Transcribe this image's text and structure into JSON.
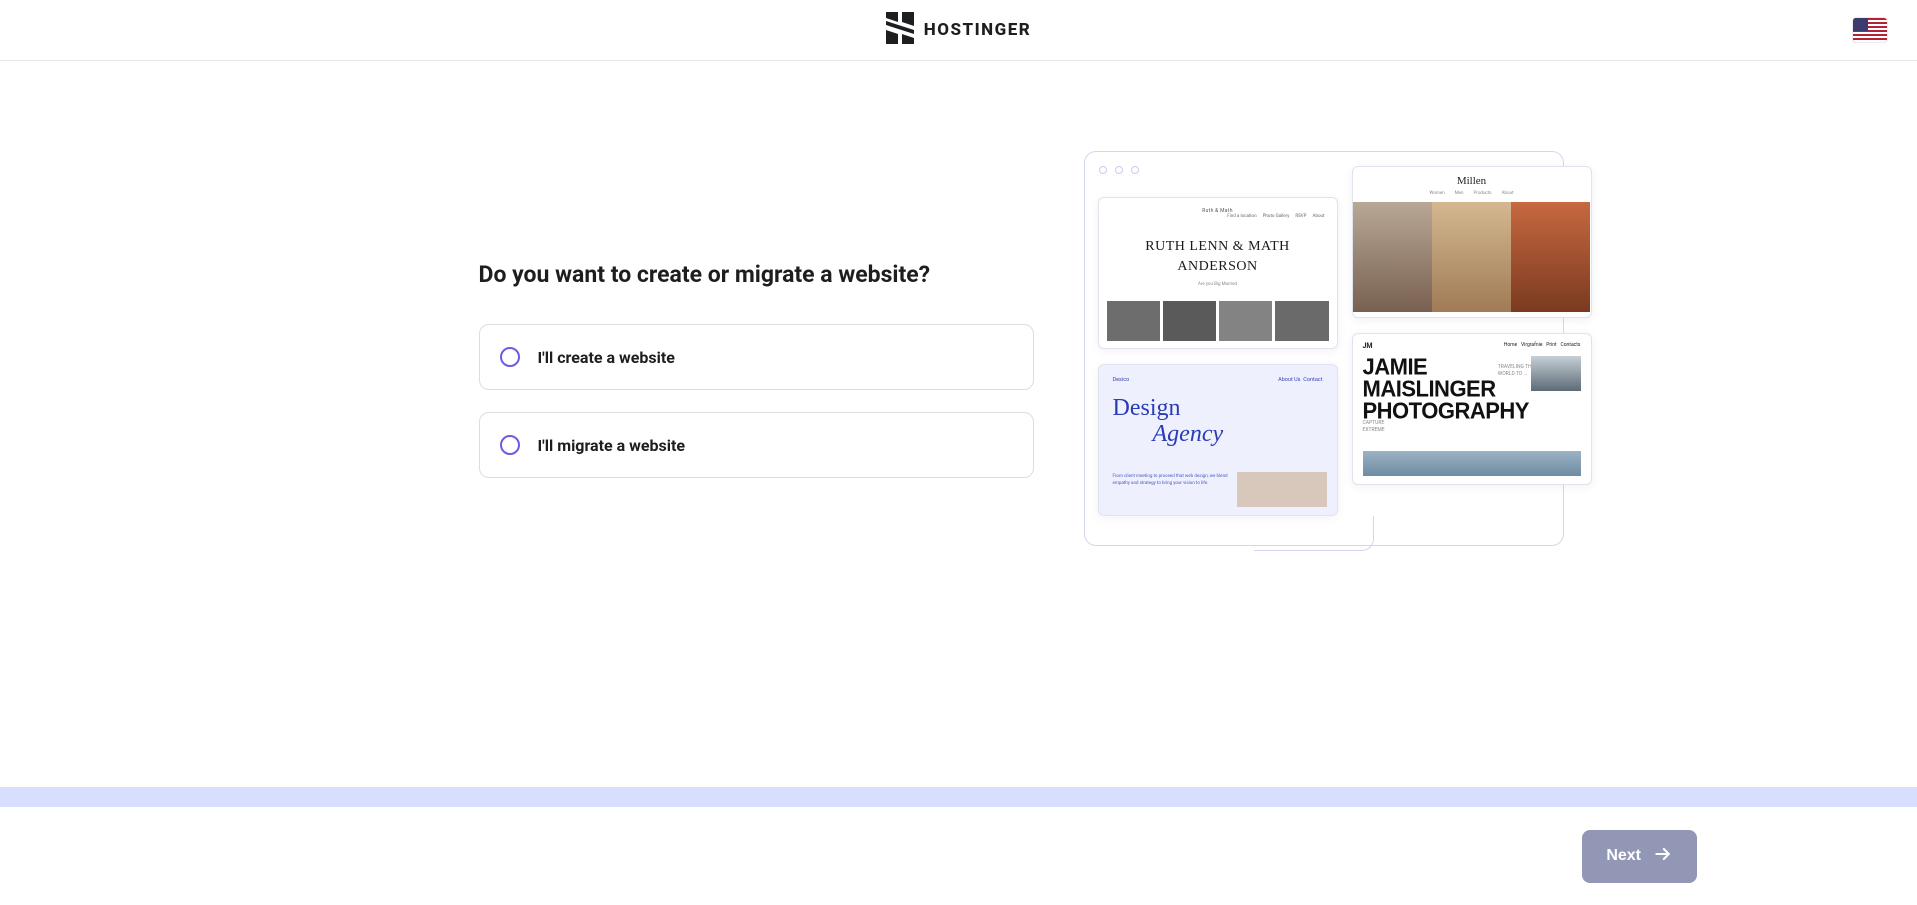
{
  "header": {
    "brand": "HOSTINGER",
    "locale_flag": "us"
  },
  "question": "Do you want to create or migrate a website?",
  "options": [
    {
      "id": "create",
      "label": "I'll create a website"
    },
    {
      "id": "migrate",
      "label": "I'll migrate a website"
    }
  ],
  "illustration": {
    "thumb1": {
      "small_label": "Ruth & Math",
      "nav": [
        "Find a location",
        "Photo Gallery",
        "RSVP",
        "About"
      ],
      "title_line1": "RUTH LENN & MATH",
      "title_line2": "ANDERSON",
      "subtitle": "Are you Big Married"
    },
    "thumb2": {
      "brand": "Millen",
      "nav": [
        "Women",
        "Men",
        "Products",
        "About"
      ]
    },
    "thumb3": {
      "logo": "Desico",
      "nav": [
        "About Us",
        "Contact"
      ],
      "title_line1": "Design",
      "title_line2": "Agency",
      "desc": "From client meeting to proceed that web design, we blend empathy and strategy to bring your vision to life."
    },
    "thumb4": {
      "logo": "JM",
      "nav": [
        "Home",
        "Virgrafnie",
        "Print",
        "Contacts"
      ],
      "line1": "JAMIE",
      "line2": "MAISLINGER",
      "line3": "PHOTOGRAPHY",
      "side_top1": "TRAVELING THE",
      "side_top2": "WORLD TO ...",
      "side_left1": "CAPTURE",
      "side_left2": "EXTREME"
    }
  },
  "footer": {
    "next_label": "Next"
  }
}
